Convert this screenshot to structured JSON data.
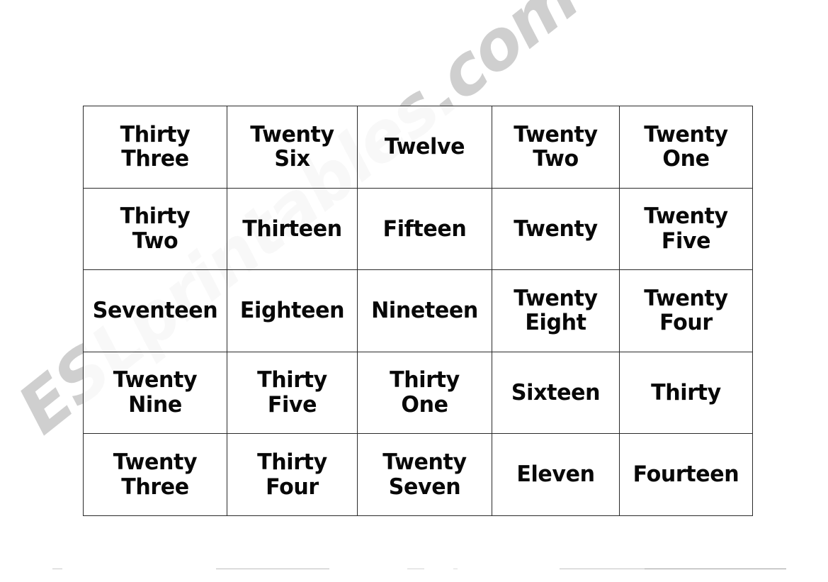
{
  "page": {
    "background_color": "#ffffff",
    "text_color": "#080808",
    "border_color": "#2a2a2a"
  },
  "watermark": {
    "text": "ESLprintables.com",
    "color": "#cfcfcf",
    "rotation_deg": -38.5
  },
  "bingo_card": {
    "columns": 5,
    "rows": 5,
    "grid": [
      [
        {
          "label": "Thirty\nThree",
          "number": 33
        },
        {
          "label": "Twenty\nSix",
          "number": 26
        },
        {
          "label": "Twelve",
          "number": 12
        },
        {
          "label": "Twenty\nTwo",
          "number": 22
        },
        {
          "label": "Twenty\nOne",
          "number": 21
        }
      ],
      [
        {
          "label": "Thirty\nTwo",
          "number": 32
        },
        {
          "label": "Thirteen",
          "number": 13
        },
        {
          "label": "Fifteen",
          "number": 15
        },
        {
          "label": "Twenty",
          "number": 20
        },
        {
          "label": "Twenty\nFive",
          "number": 25
        }
      ],
      [
        {
          "label": "Seventeen",
          "number": 17
        },
        {
          "label": "Eighteen",
          "number": 18
        },
        {
          "label": "Nineteen",
          "number": 19
        },
        {
          "label": "Twenty\nEight",
          "number": 28
        },
        {
          "label": "Twenty\nFour",
          "number": 24
        }
      ],
      [
        {
          "label": "Twenty\nNine",
          "number": 29
        },
        {
          "label": "Thirty\nFive",
          "number": 35
        },
        {
          "label": "Thirty\nOne",
          "number": 31
        },
        {
          "label": "Sixteen",
          "number": 16
        },
        {
          "label": "Thirty",
          "number": 30
        }
      ],
      [
        {
          "label": "Twenty\nThree",
          "number": 23
        },
        {
          "label": "Thirty\nFour",
          "number": 34
        },
        {
          "label": "Twenty\nSeven",
          "number": 27
        },
        {
          "label": "Eleven",
          "number": 11
        },
        {
          "label": "Fourteen",
          "number": 14
        }
      ]
    ]
  }
}
